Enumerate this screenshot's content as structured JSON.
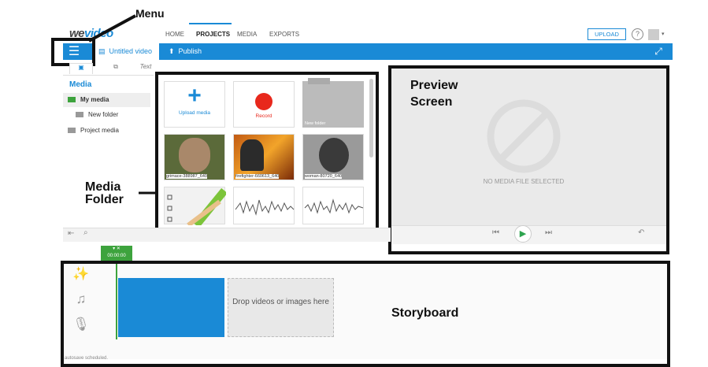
{
  "app": {
    "logo_a": "we",
    "logo_b": "video"
  },
  "nav": {
    "home": "HOME",
    "projects": "PROJECTS",
    "media": "MEDIA",
    "exports": "EXPORTS",
    "upload": "UPLOAD",
    "help": "?"
  },
  "toolbar": {
    "project_title": "Untitled video",
    "publish": "Publish",
    "menu_icon": "hamburger-icon"
  },
  "annotations": {
    "menu": "Menu",
    "preview": "Preview\nScreen",
    "media_folder": "Media\nFolder",
    "storyboard": "Storyboard"
  },
  "media_panel": {
    "tab_text": "Text",
    "title": "Media",
    "folders": [
      {
        "label": "My media"
      },
      {
        "label": "New folder"
      },
      {
        "label": "Project media"
      }
    ],
    "tiles": [
      {
        "label": "Upload media"
      },
      {
        "label": "Record"
      },
      {
        "label": "New folder"
      },
      {
        "label": "grimace-388987_640"
      },
      {
        "label": "firefighter-660613_640"
      },
      {
        "label": "woman-80720_640"
      }
    ]
  },
  "preview": {
    "empty_text": "NO MEDIA FILE SELECTED"
  },
  "timeline": {
    "marker_time": "00:00:00",
    "drop_text": "Drop videos or images here",
    "autosave": "autosave scheduled."
  },
  "colors": {
    "accent": "#1a8ad6",
    "green": "#3da33d",
    "record": "#e8281c"
  }
}
